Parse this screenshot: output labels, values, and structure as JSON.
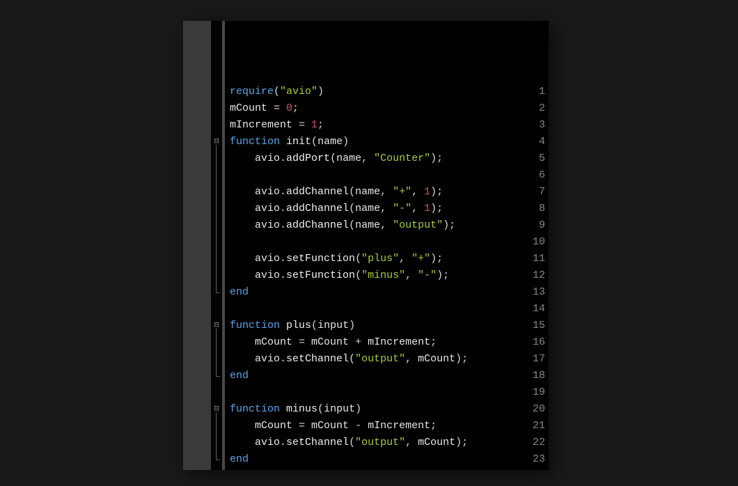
{
  "editor": {
    "lineHeight": 24,
    "topOffset": 90,
    "lines": [
      {
        "n": "1",
        "fold": null,
        "tokens": [
          {
            "cls": "kw",
            "t": "require"
          },
          {
            "cls": "op",
            "t": "("
          },
          {
            "cls": "str",
            "t": "\"avio\""
          },
          {
            "cls": "op",
            "t": ")"
          }
        ]
      },
      {
        "n": "2",
        "fold": null,
        "tokens": [
          {
            "cls": "id",
            "t": "mCount"
          },
          {
            "cls": "op",
            "t": " = "
          },
          {
            "cls": "num",
            "t": "0"
          },
          {
            "cls": "op",
            "t": ";"
          }
        ]
      },
      {
        "n": "3",
        "fold": null,
        "tokens": [
          {
            "cls": "id",
            "t": "mIncrement"
          },
          {
            "cls": "op",
            "t": " = "
          },
          {
            "cls": "num",
            "t": "1"
          },
          {
            "cls": "op",
            "t": ";"
          }
        ]
      },
      {
        "n": "4",
        "fold": "open",
        "tokens": [
          {
            "cls": "kw",
            "t": "function"
          },
          {
            "cls": "plain",
            "t": " "
          },
          {
            "cls": "fn",
            "t": "init"
          },
          {
            "cls": "op",
            "t": "("
          },
          {
            "cls": "id",
            "t": "name"
          },
          {
            "cls": "op",
            "t": ")"
          }
        ]
      },
      {
        "n": "5",
        "fold": "mid",
        "tokens": [
          {
            "cls": "plain",
            "t": "    "
          },
          {
            "cls": "id",
            "t": "avio"
          },
          {
            "cls": "op",
            "t": "."
          },
          {
            "cls": "fn",
            "t": "addPort"
          },
          {
            "cls": "op",
            "t": "("
          },
          {
            "cls": "id",
            "t": "name"
          },
          {
            "cls": "op",
            "t": ", "
          },
          {
            "cls": "str",
            "t": "\"Counter\""
          },
          {
            "cls": "op",
            "t": ");"
          }
        ]
      },
      {
        "n": "6",
        "fold": "mid",
        "tokens": []
      },
      {
        "n": "7",
        "fold": "mid",
        "tokens": [
          {
            "cls": "plain",
            "t": "    "
          },
          {
            "cls": "id",
            "t": "avio"
          },
          {
            "cls": "op",
            "t": "."
          },
          {
            "cls": "fn",
            "t": "addChannel"
          },
          {
            "cls": "op",
            "t": "("
          },
          {
            "cls": "id",
            "t": "name"
          },
          {
            "cls": "op",
            "t": ", "
          },
          {
            "cls": "str",
            "t": "\"+\""
          },
          {
            "cls": "op",
            "t": ", "
          },
          {
            "cls": "num",
            "t": "1"
          },
          {
            "cls": "op",
            "t": ");"
          }
        ]
      },
      {
        "n": "8",
        "fold": "mid",
        "tokens": [
          {
            "cls": "plain",
            "t": "    "
          },
          {
            "cls": "id",
            "t": "avio"
          },
          {
            "cls": "op",
            "t": "."
          },
          {
            "cls": "fn",
            "t": "addChannel"
          },
          {
            "cls": "op",
            "t": "("
          },
          {
            "cls": "id",
            "t": "name"
          },
          {
            "cls": "op",
            "t": ", "
          },
          {
            "cls": "str",
            "t": "\"-\""
          },
          {
            "cls": "op",
            "t": ", "
          },
          {
            "cls": "num",
            "t": "1"
          },
          {
            "cls": "op",
            "t": ");"
          }
        ]
      },
      {
        "n": "9",
        "fold": "mid",
        "tokens": [
          {
            "cls": "plain",
            "t": "    "
          },
          {
            "cls": "id",
            "t": "avio"
          },
          {
            "cls": "op",
            "t": "."
          },
          {
            "cls": "fn",
            "t": "addChannel"
          },
          {
            "cls": "op",
            "t": "("
          },
          {
            "cls": "id",
            "t": "name"
          },
          {
            "cls": "op",
            "t": ", "
          },
          {
            "cls": "str",
            "t": "\"output\""
          },
          {
            "cls": "op",
            "t": ");"
          }
        ]
      },
      {
        "n": "10",
        "fold": "mid",
        "tokens": []
      },
      {
        "n": "11",
        "fold": "mid",
        "tokens": [
          {
            "cls": "plain",
            "t": "    "
          },
          {
            "cls": "id",
            "t": "avio"
          },
          {
            "cls": "op",
            "t": "."
          },
          {
            "cls": "fn",
            "t": "setFunction"
          },
          {
            "cls": "op",
            "t": "("
          },
          {
            "cls": "str",
            "t": "\"plus\""
          },
          {
            "cls": "op",
            "t": ", "
          },
          {
            "cls": "str",
            "t": "\"+\""
          },
          {
            "cls": "op",
            "t": ");"
          }
        ]
      },
      {
        "n": "12",
        "fold": "mid",
        "tokens": [
          {
            "cls": "plain",
            "t": "    "
          },
          {
            "cls": "id",
            "t": "avio"
          },
          {
            "cls": "op",
            "t": "."
          },
          {
            "cls": "fn",
            "t": "setFunction"
          },
          {
            "cls": "op",
            "t": "("
          },
          {
            "cls": "str",
            "t": "\"minus\""
          },
          {
            "cls": "op",
            "t": ", "
          },
          {
            "cls": "str",
            "t": "\"-\""
          },
          {
            "cls": "op",
            "t": ");"
          }
        ]
      },
      {
        "n": "13",
        "fold": "close",
        "tokens": [
          {
            "cls": "kw",
            "t": "end"
          }
        ]
      },
      {
        "n": "14",
        "fold": null,
        "tokens": []
      },
      {
        "n": "15",
        "fold": "open",
        "tokens": [
          {
            "cls": "kw",
            "t": "function"
          },
          {
            "cls": "plain",
            "t": " "
          },
          {
            "cls": "fn",
            "t": "plus"
          },
          {
            "cls": "op",
            "t": "("
          },
          {
            "cls": "id",
            "t": "input"
          },
          {
            "cls": "op",
            "t": ")"
          }
        ]
      },
      {
        "n": "16",
        "fold": "mid",
        "tokens": [
          {
            "cls": "plain",
            "t": "    "
          },
          {
            "cls": "id",
            "t": "mCount"
          },
          {
            "cls": "op",
            "t": " = "
          },
          {
            "cls": "id",
            "t": "mCount"
          },
          {
            "cls": "op",
            "t": " + "
          },
          {
            "cls": "id",
            "t": "mIncrement"
          },
          {
            "cls": "op",
            "t": ";"
          }
        ]
      },
      {
        "n": "17",
        "fold": "mid",
        "tokens": [
          {
            "cls": "plain",
            "t": "    "
          },
          {
            "cls": "id",
            "t": "avio"
          },
          {
            "cls": "op",
            "t": "."
          },
          {
            "cls": "fn",
            "t": "setChannel"
          },
          {
            "cls": "op",
            "t": "("
          },
          {
            "cls": "str",
            "t": "\"output\""
          },
          {
            "cls": "op",
            "t": ", "
          },
          {
            "cls": "id",
            "t": "mCount"
          },
          {
            "cls": "op",
            "t": ");"
          }
        ]
      },
      {
        "n": "18",
        "fold": "close",
        "tokens": [
          {
            "cls": "kw",
            "t": "end"
          }
        ]
      },
      {
        "n": "19",
        "fold": null,
        "tokens": []
      },
      {
        "n": "20",
        "fold": "open",
        "tokens": [
          {
            "cls": "kw",
            "t": "function"
          },
          {
            "cls": "plain",
            "t": " "
          },
          {
            "cls": "fn",
            "t": "minus"
          },
          {
            "cls": "op",
            "t": "("
          },
          {
            "cls": "id",
            "t": "input"
          },
          {
            "cls": "op",
            "t": ")"
          }
        ]
      },
      {
        "n": "21",
        "fold": "mid",
        "tokens": [
          {
            "cls": "plain",
            "t": "    "
          },
          {
            "cls": "id",
            "t": "mCount"
          },
          {
            "cls": "op",
            "t": " = "
          },
          {
            "cls": "id",
            "t": "mCount"
          },
          {
            "cls": "op",
            "t": " - "
          },
          {
            "cls": "id",
            "t": "mIncrement"
          },
          {
            "cls": "op",
            "t": ";"
          }
        ]
      },
      {
        "n": "22",
        "fold": "mid",
        "tokens": [
          {
            "cls": "plain",
            "t": "    "
          },
          {
            "cls": "id",
            "t": "avio"
          },
          {
            "cls": "op",
            "t": "."
          },
          {
            "cls": "fn",
            "t": "setChannel"
          },
          {
            "cls": "op",
            "t": "("
          },
          {
            "cls": "str",
            "t": "\"output\""
          },
          {
            "cls": "op",
            "t": ", "
          },
          {
            "cls": "id",
            "t": "mCount"
          },
          {
            "cls": "op",
            "t": ");"
          }
        ]
      },
      {
        "n": "23",
        "fold": "close",
        "tokens": [
          {
            "cls": "kw",
            "t": "end"
          }
        ]
      }
    ],
    "foldGlyphOpen": "⊟",
    "foldGlyphCloseCorner": "└"
  }
}
